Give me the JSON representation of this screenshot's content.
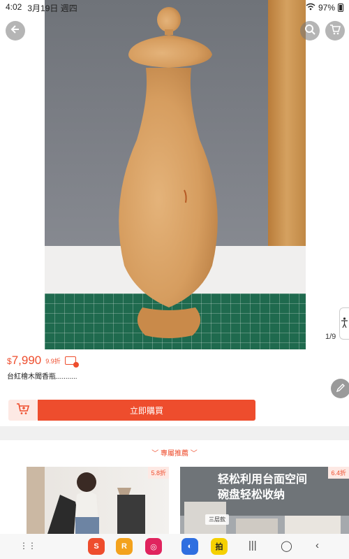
{
  "status": {
    "time": "4:02",
    "date": "3月19日 週四",
    "battery": "97%"
  },
  "gallery": {
    "counter": "1/9"
  },
  "product": {
    "currency": "$",
    "price": "7,990",
    "discount": "9.9折",
    "title": "台紅檜木聞香瓶..........."
  },
  "actions": {
    "buy_label": "立即購買"
  },
  "recommend": {
    "heading": "專屬推薦",
    "cards": [
      {
        "badge": "5.8折"
      },
      {
        "badge": "6.4折",
        "headline_1": "轻松利用台面空间",
        "headline_2": "碗盘轻松收纳",
        "tag": "三层款"
      }
    ]
  },
  "colors": {
    "accent": "#ee4d2d"
  },
  "icons": [
    "back-icon",
    "search-icon",
    "cart-icon",
    "accessibility-icon",
    "edit-icon",
    "coupon-icon",
    "add-to-cart-icon"
  ]
}
